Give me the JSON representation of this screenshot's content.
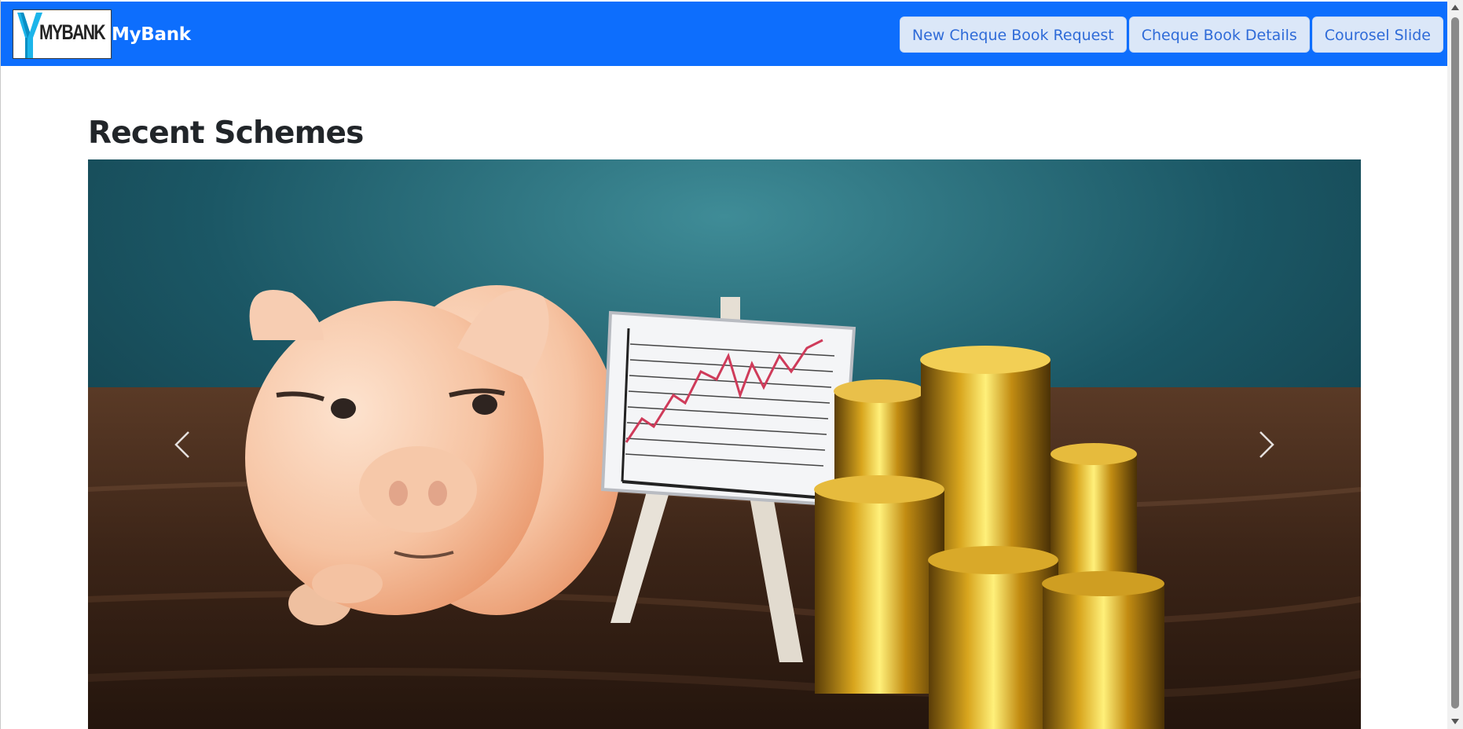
{
  "navbar": {
    "logo_text": "MYBANK",
    "brand_name": "MyBank",
    "buttons": [
      {
        "label": "New Cheque Book Request"
      },
      {
        "label": "Cheque Book Details"
      },
      {
        "label": "Courosel Slide"
      }
    ],
    "background_color": "#0d6efd"
  },
  "main": {
    "section_title": "Recent Schemes",
    "carousel": {
      "prev_icon": "chevron-left-icon",
      "next_icon": "chevron-right-icon"
    }
  }
}
